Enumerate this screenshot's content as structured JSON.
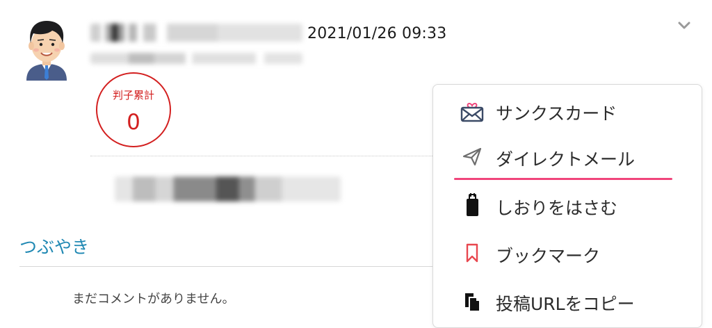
{
  "post": {
    "timestamp": "2021/01/26 09:33",
    "stamp_label": "判子累計",
    "stamp_count": "0"
  },
  "tweets": {
    "title": "つぶやき",
    "empty_message": "まだコメントがありません。"
  },
  "menu": {
    "items": [
      {
        "label": "サンクスカード",
        "icon": "envelope-heart-icon"
      },
      {
        "label": "ダイレクトメール",
        "icon": "paper-plane-icon"
      },
      {
        "label": "しおりをはさむ",
        "icon": "bookmark-clip-icon"
      },
      {
        "label": "ブックマーク",
        "icon": "bookmark-icon"
      },
      {
        "label": "投稿URLをコピー",
        "icon": "copy-icon"
      }
    ],
    "accent_color": "#f0457b"
  },
  "colors": {
    "stamp": "#d31f1f",
    "link": "#1f88b3"
  }
}
